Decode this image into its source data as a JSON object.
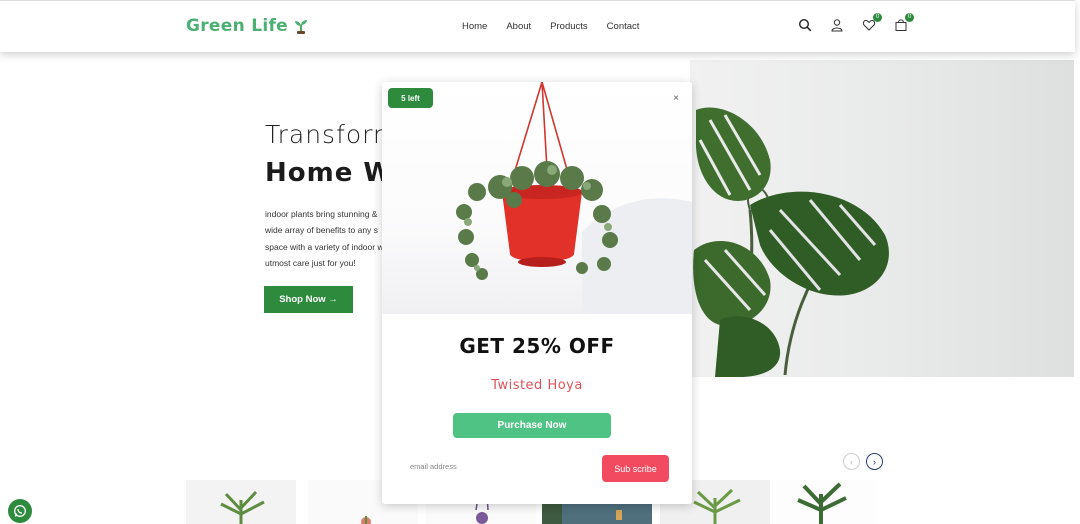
{
  "header": {
    "logo": "Green Life",
    "nav": [
      "Home",
      "About",
      "Products",
      "Contact"
    ],
    "wishlist_count": "0",
    "cart_count": "0"
  },
  "hero": {
    "title_line1": "Transform",
    "title_line2": "Home W",
    "text": "indoor plants bring stunning & wide array of benefits to any s space with a variety of indoor with utmost care just for you!",
    "cta": "Shop Now →"
  },
  "popup": {
    "badge": "5 left",
    "close": "×",
    "offer": "GET 25% OFF",
    "product": "Twisted Hoya",
    "purchase": "Purchase Now",
    "email_placeholder": "email address",
    "subscribe": "Sub scribe"
  },
  "colors": {
    "brand_green": "#2e8b3e",
    "logo_green": "#4caf73",
    "purchase_green": "#4fc383",
    "subscribe_red": "#f24a5f",
    "product_pink": "#e0525b"
  }
}
